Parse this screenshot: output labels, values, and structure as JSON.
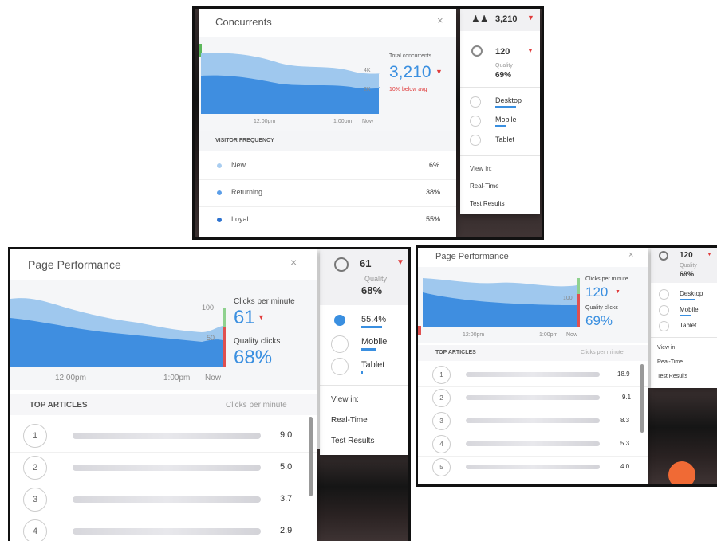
{
  "colors": {
    "accent": "#3a8fe0",
    "down": "#e03c3c",
    "area_light": "#9fc8ee",
    "area_dark": "#3f8ee0"
  },
  "top": {
    "header": {
      "concurrents": "3,210"
    },
    "panel": {
      "title": "Concurrents",
      "total_label": "Total concurrents",
      "total_value": "3,210",
      "below": "10% below avg",
      "y_ticks": [
        "4K",
        "2K"
      ],
      "x_ticks": [
        "12:00pm",
        "1:00pm",
        "Now"
      ],
      "freq_header": "VISITOR FREQUENCY",
      "freq": [
        {
          "label": "New",
          "value": "6%",
          "color": "#a9cdf0"
        },
        {
          "label": "Returning",
          "value": "38%",
          "color": "#5b9ee8"
        },
        {
          "label": "Loyal",
          "value": "55%",
          "color": "#2e73d0"
        }
      ]
    },
    "side": {
      "clicks": "120",
      "quality_label": "Quality",
      "quality_value": "69%",
      "devices": [
        "Desktop",
        "Mobile",
        "Tablet"
      ],
      "view_in": "View in:",
      "links": [
        "Real-Time",
        "Test Results"
      ]
    }
  },
  "left": {
    "panel": {
      "title": "Page Performance",
      "y_ticks": [
        "100",
        "50"
      ],
      "x_ticks": [
        "12:00pm",
        "1:00pm",
        "Now"
      ],
      "cpm_label": "Clicks per minute",
      "cpm_value": "61",
      "qc_label": "Quality clicks",
      "qc_value": "68%",
      "articles_header": "TOP ARTICLES",
      "articles_col": "Clicks per minute",
      "articles": [
        {
          "rank": "1",
          "value": "9.0"
        },
        {
          "rank": "2",
          "value": "5.0"
        },
        {
          "rank": "3",
          "value": "3.7"
        },
        {
          "rank": "4",
          "value": "2.9"
        }
      ]
    },
    "side": {
      "clicks": "61",
      "quality_label": "Quality",
      "quality_value": "68%",
      "devices": [
        "55.4%",
        "Mobile",
        "Tablet"
      ],
      "view_in": "View in:",
      "links": [
        "Real-Time",
        "Test Results"
      ]
    }
  },
  "right": {
    "panel": {
      "title": "Page Performance",
      "y_ticks": [
        "100"
      ],
      "x_ticks": [
        "12:00pm",
        "1:00pm",
        "Now"
      ],
      "cpm_label": "Clicks per minute",
      "cpm_value": "120",
      "qc_label": "Quality clicks",
      "qc_value": "69%",
      "articles_header": "TOP ARTICLES",
      "articles_col": "Clicks per minute",
      "articles": [
        {
          "rank": "1",
          "value": "18.9"
        },
        {
          "rank": "2",
          "value": "9.1"
        },
        {
          "rank": "3",
          "value": "8.3"
        },
        {
          "rank": "4",
          "value": "5.3"
        },
        {
          "rank": "5",
          "value": "4.0"
        }
      ]
    },
    "side": {
      "clicks": "120",
      "quality_label": "Quality",
      "quality_value": "69%",
      "devices": [
        "Desktop",
        "Mobile",
        "Tablet"
      ],
      "view_in": "View in:",
      "links": [
        "Real-Time",
        "Test Results"
      ]
    }
  }
}
